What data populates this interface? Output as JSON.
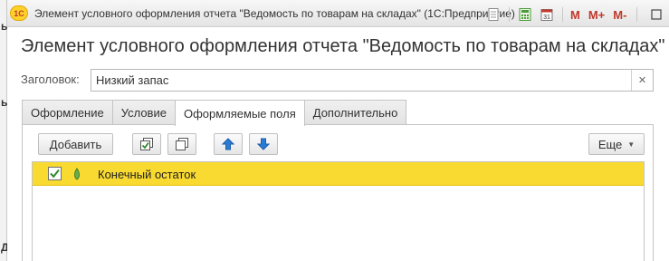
{
  "window": {
    "title": "Элемент условного оформления отчета \"Ведомость по товарам на складах\"  (1С:Предприятие)",
    "logo_text": "1С",
    "memory_buttons": [
      "M",
      "M+",
      "M-"
    ],
    "icons": [
      "print-preview-icon",
      "calculator-icon",
      "calendar-icon",
      "restore-icon",
      "close-icon"
    ]
  },
  "left_strip": {
    "marks": [
      "ь",
      "ь",
      "Д"
    ]
  },
  "heading": "Элемент условного оформления отчета \"Ведомость по товарам на складах\"",
  "header_field": {
    "label": "Заголовок:",
    "value": "Низкий запас"
  },
  "tabs": [
    {
      "label": "Оформление",
      "active": false
    },
    {
      "label": "Условие",
      "active": false
    },
    {
      "label": "Оформляемые поля",
      "active": true
    },
    {
      "label": "Дополнительно",
      "active": false
    }
  ],
  "toolbar": {
    "add_label": "Добавить",
    "more_label": "Еще",
    "icons": [
      "check-all-icon",
      "uncheck-all-icon",
      "move-up-icon",
      "move-down-icon"
    ]
  },
  "fields": [
    {
      "checked": true,
      "label": "Конечный остаток"
    }
  ],
  "colors": {
    "selected_row": "#f9da30",
    "logo": "#ffd12b",
    "memory_buttons": "#c0392b",
    "arrow_buttons": "#2a7bd4"
  }
}
